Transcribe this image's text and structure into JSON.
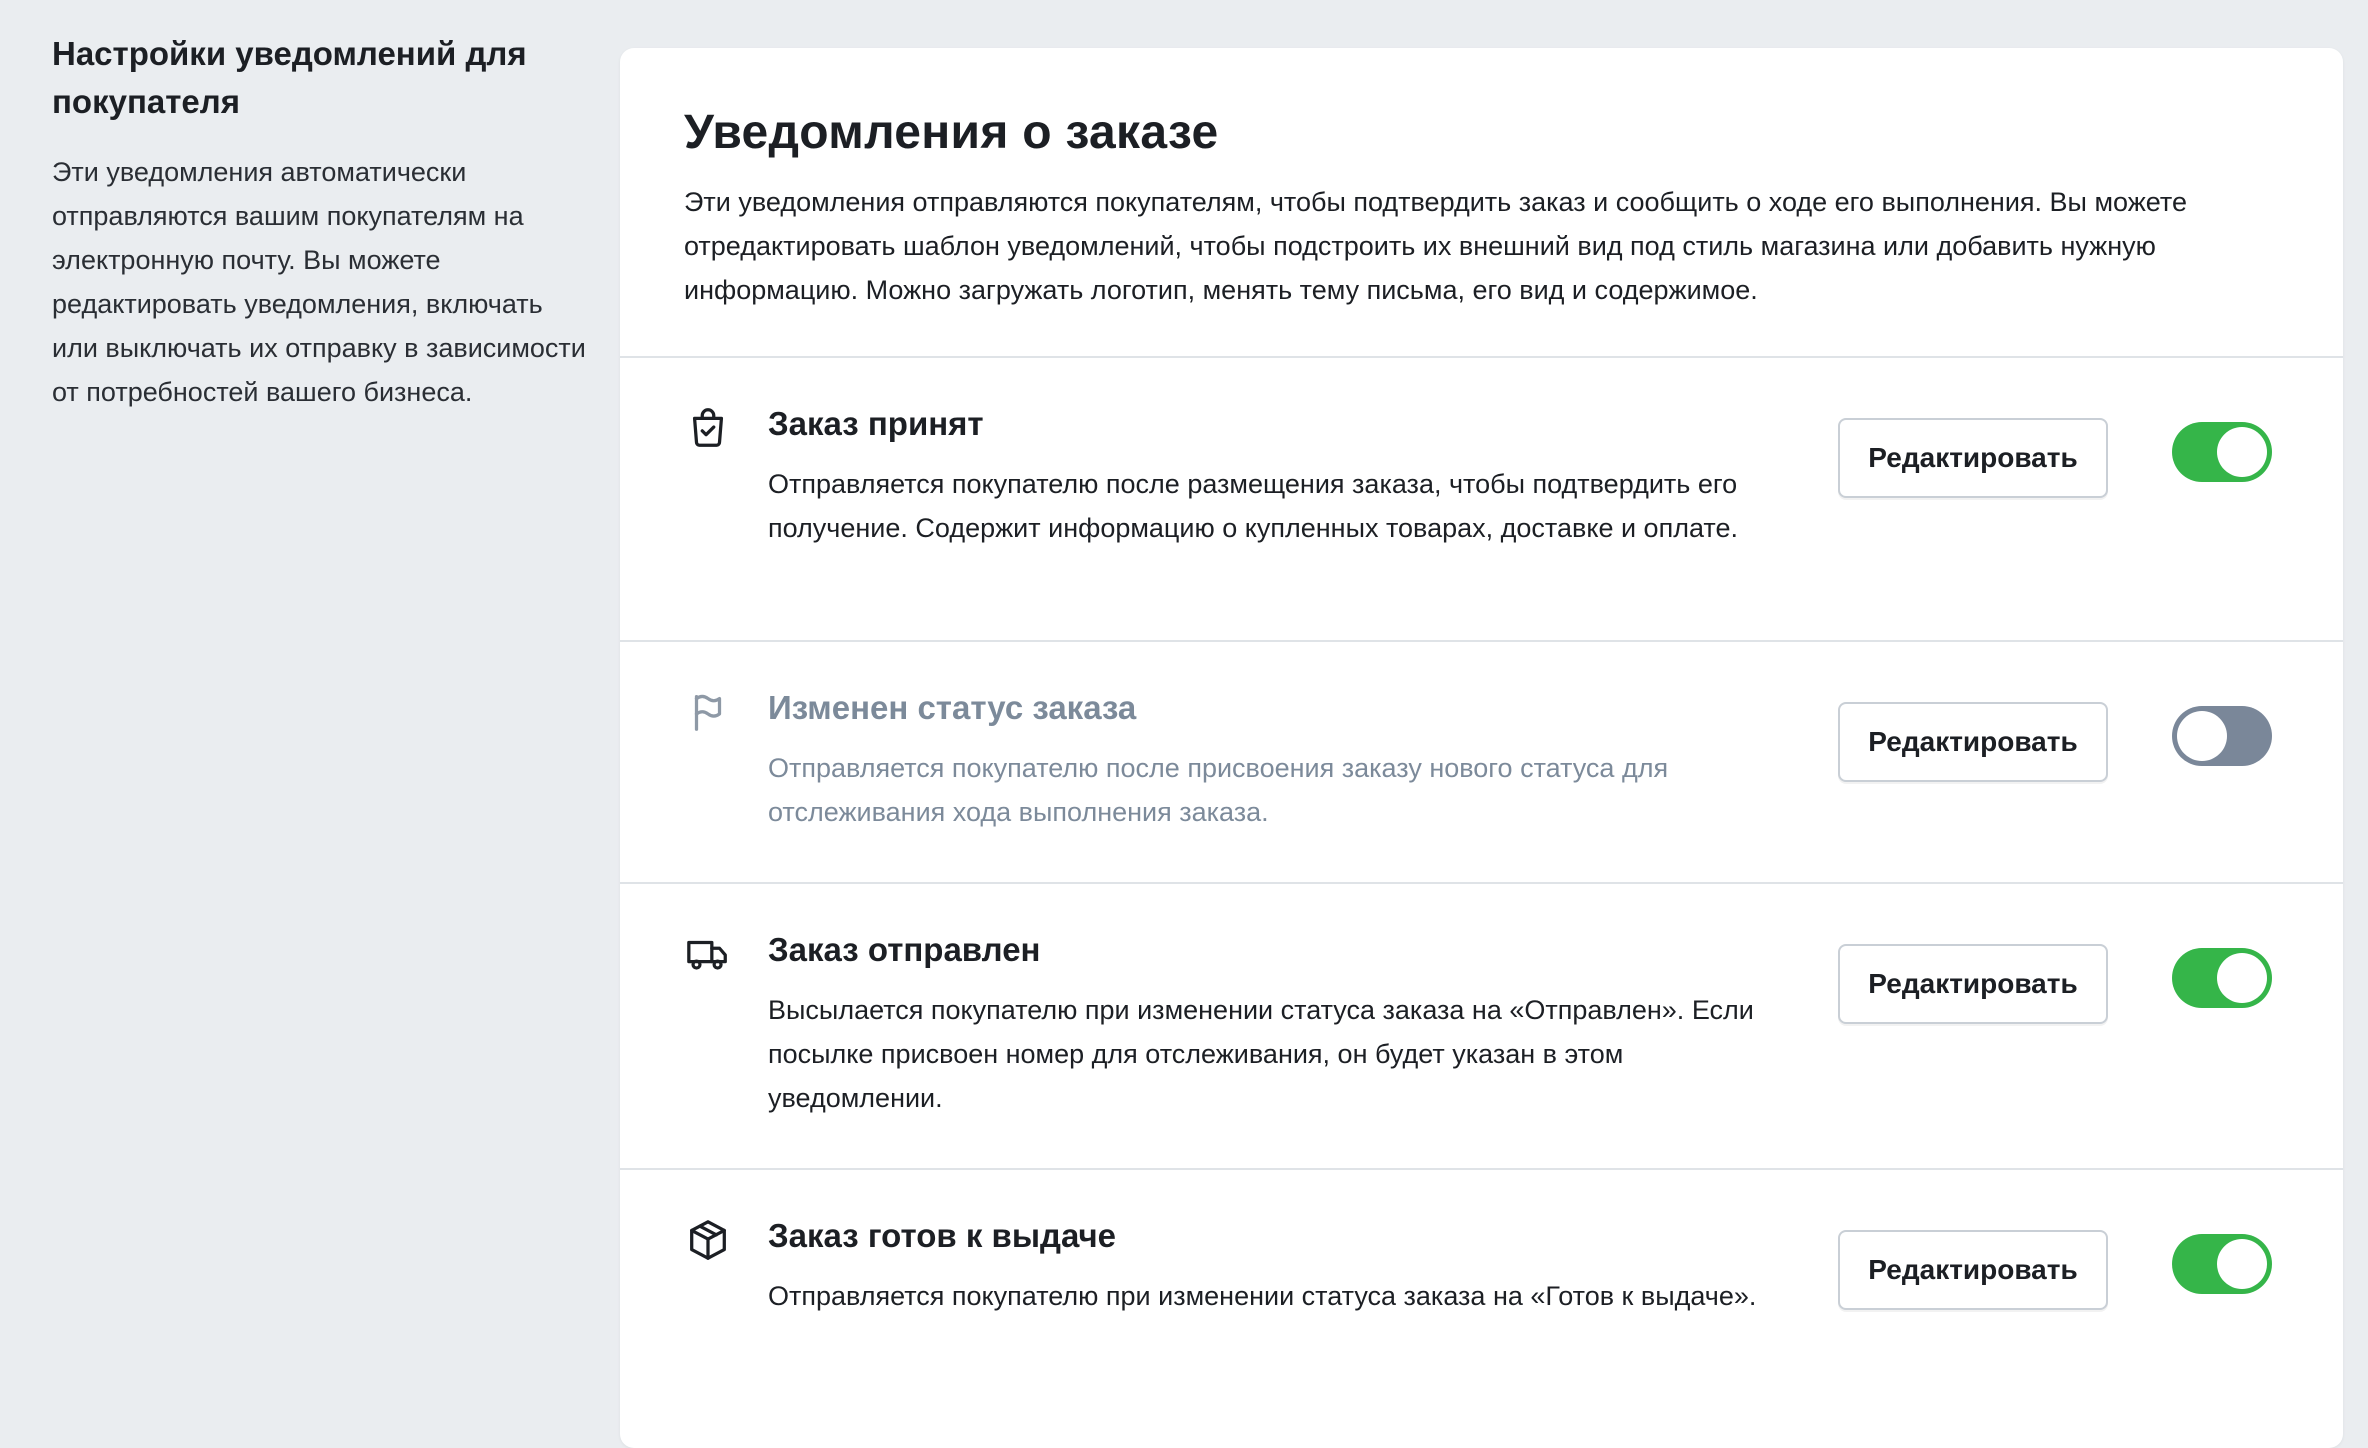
{
  "sidebar": {
    "title": "Настройки уведомлений для покупателя",
    "description": "Эти уведомления автоматически отправляются вашим покупателям на электронную почту. Вы можете редактировать уведомления, включать или выключать их отправку в зависимости от потребностей вашего бизнеса."
  },
  "card": {
    "title": "Уведомления о заказе",
    "description": "Эти уведомления отправляются покупателям, чтобы подтвердить заказ и сообщить о ходе его выполнения. Вы можете отредактировать шаблон уведомлений, чтобы подстроить их внешний вид под стиль магазина или добавить нужную информацию. Можно загружать логотип, менять тему письма, его вид и содержимое."
  },
  "notifications": [
    {
      "icon": "shopping-bag-check-icon",
      "title": "Заказ принят",
      "description": "Отправляется покупателю после размещения заказа, чтобы подтвердить его получение. Содержит информацию о купленных товарах, доставке и оплате.",
      "edit_label": "Редактировать",
      "enabled": true
    },
    {
      "icon": "flag-icon",
      "title": "Изменен статус заказа",
      "description": "Отправляется покупателю после присвоения заказу нового статуса для отслеживания хода выполнения заказа.",
      "edit_label": "Редактировать",
      "enabled": false
    },
    {
      "icon": "truck-icon",
      "title": "Заказ отправлен",
      "description": "Высылается покупателю при изменении статуса заказа на «Отправлен». Если посылке присвоен номер для отслеживания, он будет указан в этом уведомлении.",
      "edit_label": "Редактировать",
      "enabled": true
    },
    {
      "icon": "package-box-icon",
      "title": "Заказ готов к выдаче",
      "description": "Отправляется покупателю при изменении статуса заказа на «Готов к выдаче».",
      "edit_label": "Редактировать",
      "enabled": true
    }
  ],
  "colors": {
    "page_background": "#eaedf0",
    "toggle_on": "#35b549",
    "toggle_off": "#7a8799",
    "disabled_text": "#7c8a9a"
  }
}
